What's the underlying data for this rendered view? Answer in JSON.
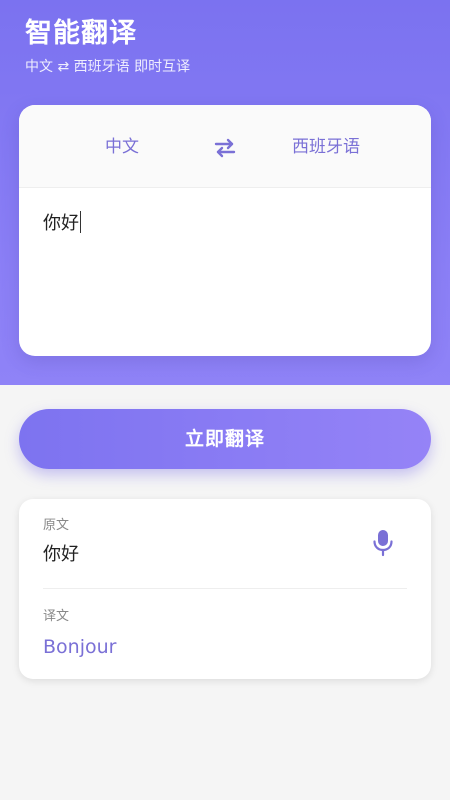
{
  "header": {
    "title": "智能翻译",
    "subtitle": "中文 ⇄ 西班牙语 即时互译"
  },
  "languages": {
    "source": "中文",
    "target": "西班牙语"
  },
  "input": {
    "value": "你好"
  },
  "actions": {
    "translate_label": "立即翻译"
  },
  "result": {
    "original_label": "原文",
    "original_text": "你好",
    "translation_label": "译文",
    "translation_text": "Bonjour"
  },
  "icons": {
    "swap": "swap-arrows-icon",
    "mic": "microphone-icon"
  },
  "colors": {
    "accent": "#7a70d6",
    "gradient_start": "#7b72f0",
    "gradient_end": "#9583f7"
  }
}
